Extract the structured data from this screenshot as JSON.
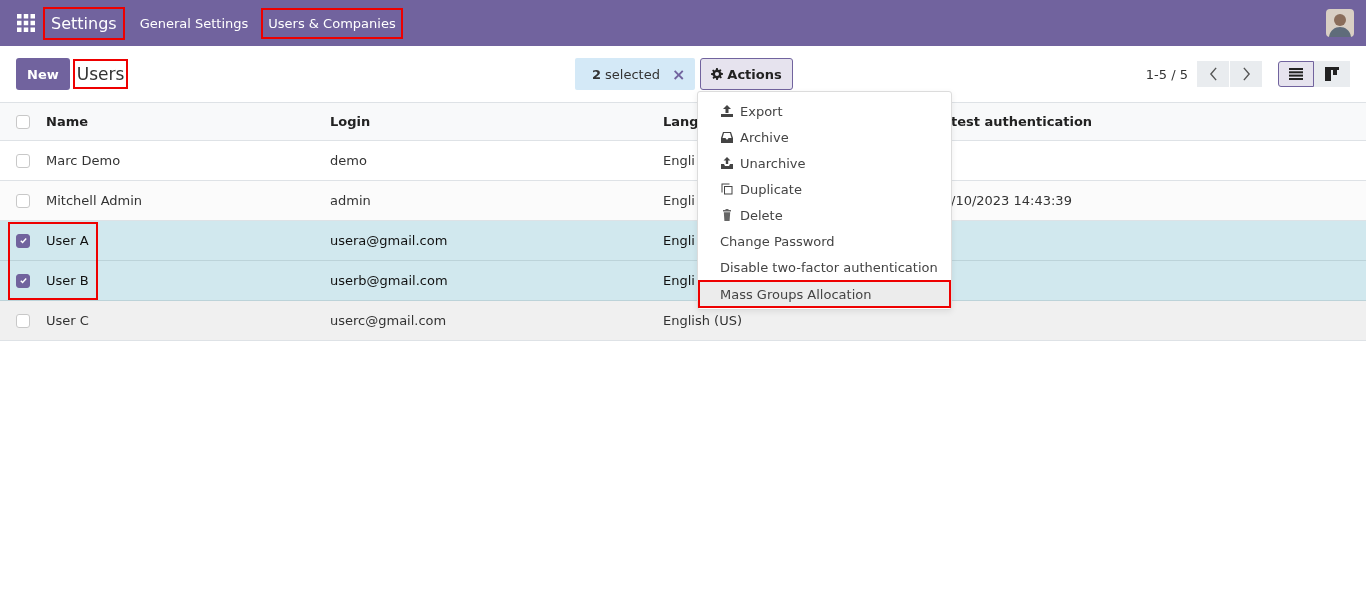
{
  "navbar": {
    "app": {
      "label": "Settings",
      "highlighted": true
    },
    "menu": [
      {
        "label": "General Settings",
        "highlighted": false
      },
      {
        "label": "Users & Companies",
        "highlighted": true
      }
    ]
  },
  "control_panel": {
    "new_button": "New",
    "title": {
      "label": "Users",
      "highlighted": true
    },
    "selection": {
      "count": "2",
      "text": "selected",
      "clear": "×"
    },
    "actions_button": "Actions",
    "pager": "1-5 / 5",
    "views": [
      {
        "kind": "list",
        "selected": true
      },
      {
        "kind": "kanban",
        "selected": false
      }
    ]
  },
  "table": {
    "all_checked": false,
    "columns": [
      "Name",
      "Login",
      "Lang",
      "test authentication"
    ],
    "rows": [
      {
        "cells": [
          "Marc Demo",
          "demo",
          "Engli",
          ""
        ],
        "checked": false,
        "highlighted": false,
        "hovered": false
      },
      {
        "cells": [
          "Mitchell Admin",
          "admin",
          "Engli",
          "/10/2023 14:43:39"
        ],
        "checked": false,
        "highlighted": false,
        "hovered": false
      },
      {
        "cells": [
          "User A",
          "usera@gmail.com",
          "Engli",
          ""
        ],
        "checked": true,
        "highlighted": true,
        "hovered": false
      },
      {
        "cells": [
          "User B",
          "userb@gmail.com",
          "Engli",
          ""
        ],
        "checked": true,
        "highlighted": true,
        "hovered": false
      },
      {
        "cells": [
          "User C",
          "userc@gmail.com",
          "English (US)",
          ""
        ],
        "checked": false,
        "highlighted": false,
        "hovered": true
      }
    ]
  },
  "actions_menu": [
    {
      "label": "Export",
      "kind": "icon",
      "highlighted": false
    },
    {
      "label": "Archive",
      "kind": "icon",
      "highlighted": false
    },
    {
      "label": "Unarchive",
      "kind": "icon",
      "highlighted": false
    },
    {
      "label": "Duplicate",
      "kind": "icon",
      "highlighted": false
    },
    {
      "label": "Delete",
      "kind": "icon",
      "highlighted": false
    },
    {
      "label": "Change Password",
      "kind": "plain",
      "highlighted": false
    },
    {
      "label": "Disable two-factor authentication",
      "kind": "plain",
      "highlighted": false
    },
    {
      "label": "Mass Groups Allocation",
      "kind": "plain",
      "highlighted": true
    }
  ]
}
